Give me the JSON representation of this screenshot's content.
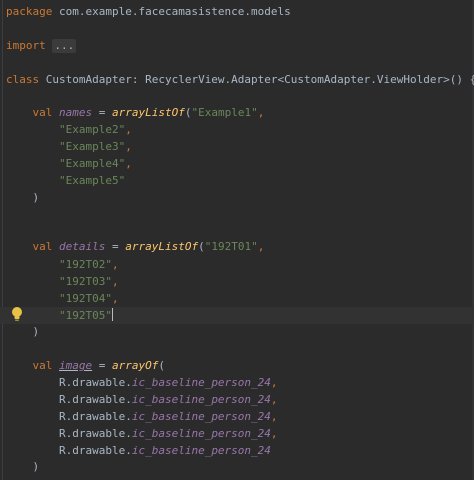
{
  "editor": {
    "package_kw": "package",
    "package_name": " com.example.facecamasistence.models",
    "import_kw": "import",
    "import_folded": "...",
    "class_kw": "class",
    "class_rest": " CustomAdapter: RecyclerView.Adapter<CustomAdapter.ViewHolder>() {",
    "val_kw": "val",
    "names_var": "names",
    "details_var": "details",
    "image_var": "image",
    "eq": " = ",
    "arrayListOf_fn": "arrayListOf",
    "arrayOf_fn": "arrayOf",
    "open_paren": "(",
    "close_paren": ")",
    "comma": ",",
    "names": [
      "\"Example1\"",
      "\"Example2\"",
      "\"Example3\"",
      "\"Example4\"",
      "\"Example5\""
    ],
    "details": [
      "\"192T01\"",
      "\"192T02\"",
      "\"192T03\"",
      "\"192T04\"",
      "\"192T05\""
    ],
    "drawable_prefix": "R.drawable.",
    "drawable_name": "ic_baseline_person_24",
    "bulb_icon": "lightbulb-icon"
  }
}
